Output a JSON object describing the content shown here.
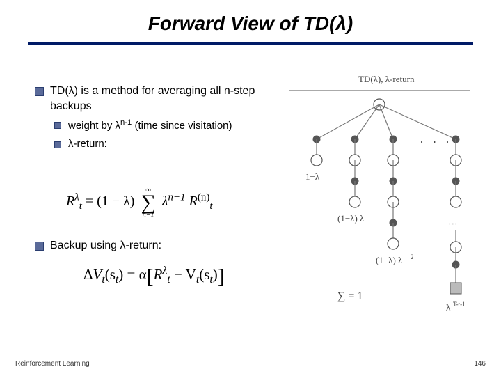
{
  "title": "Forward View of TD(λ)",
  "bullets": {
    "b1": "TD(λ) is a method for averaging all n-step backups",
    "b1a_pre": "weight by λ",
    "b1a_sup": "n-1",
    "b1a_post": " (time since visitation)",
    "b1b": "λ-return:",
    "b2": "Backup using λ-return:"
  },
  "formula1": {
    "lhs_R": "R",
    "lhs_sup": "λ",
    "lhs_sub": "t",
    "eq": " = (1 − λ)",
    "sum_top": "∞",
    "sum_sym": "∑",
    "sum_bot": "n=1",
    "rhs_lam": "λ",
    "rhs_exp": "n−1",
    "rhs_R": "R",
    "rhs_Rsup": "(n)",
    "rhs_Rsub": "t"
  },
  "formula2": {
    "delta": "Δ",
    "V": "V",
    "t": "t",
    "open": "(s",
    "close": ") = α",
    "lb": "[",
    "R": "R",
    "Rsup": "λ",
    "Rsub": "t",
    "minus": " − V",
    "rb": "]"
  },
  "diagram": {
    "title": "TD(λ), λ-return",
    "w1": "1−λ",
    "w2": "(1−λ) λ",
    "w3": "(1−λ) λ",
    "w3sup": "2",
    "wT": "λ",
    "wTsup": "T-t-1",
    "sum": "∑ = 1",
    "dots": "· · ·"
  },
  "footer": {
    "left": "Reinforcement Learning",
    "right": "146"
  }
}
